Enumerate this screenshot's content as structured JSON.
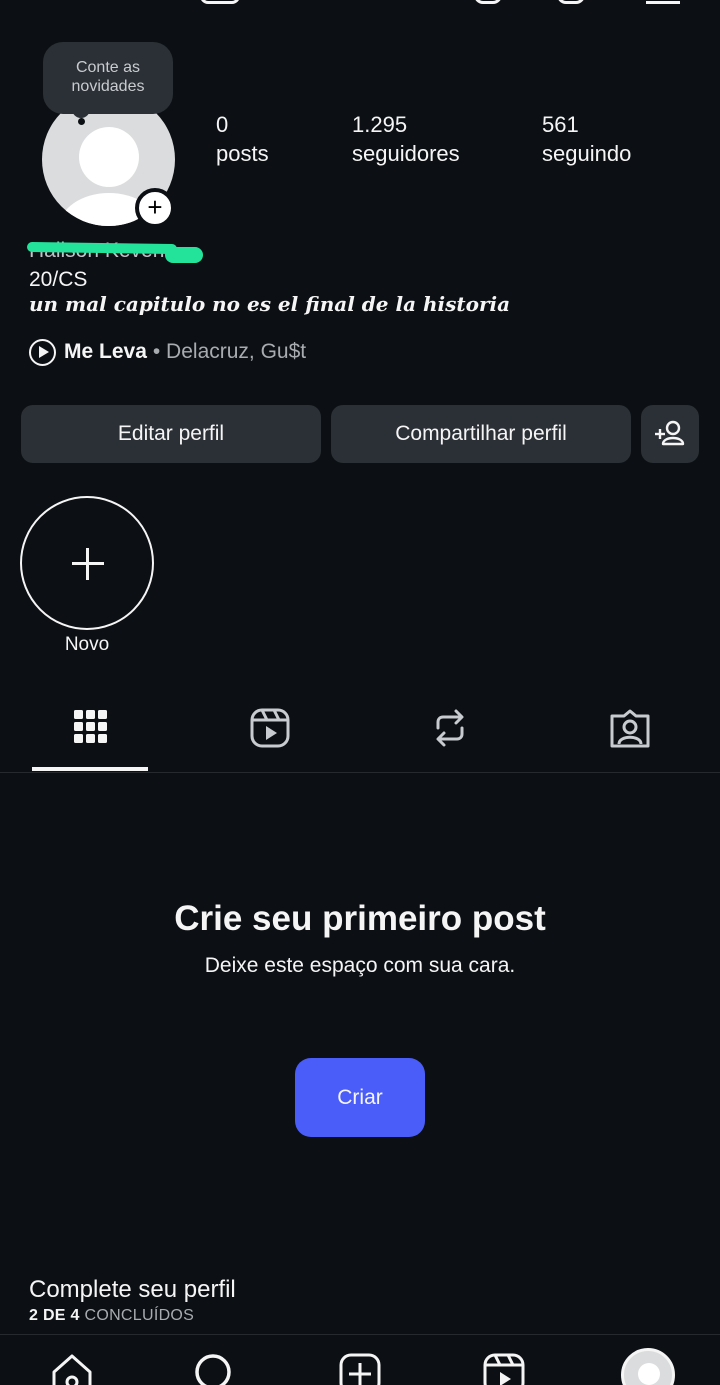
{
  "tooltip": {
    "text": "Conte as novidades"
  },
  "profile": {
    "name_redacted": "Hallson Keven",
    "bio_line1": "20/CS",
    "bio_line2": "un mal capitulo no es el final de la historia",
    "music": {
      "title": "Me Leva",
      "artist": "• Delacruz, Gu$t"
    }
  },
  "stats": [
    {
      "value": "0",
      "label": "posts"
    },
    {
      "value": "1.295",
      "label": "seguidores"
    },
    {
      "value": "561",
      "label": "seguindo"
    }
  ],
  "buttons": {
    "edit": "Editar perfil",
    "share": "Compartilhar perfil",
    "add_person_icon": "add-person-icon"
  },
  "highlight": {
    "label": "Novo"
  },
  "tabs": [
    {
      "icon": "grid-icon",
      "active": true
    },
    {
      "icon": "reels-icon",
      "active": false
    },
    {
      "icon": "repost-icon",
      "active": false
    },
    {
      "icon": "tagged-icon",
      "active": false
    }
  ],
  "empty_state": {
    "title": "Crie seu primeiro post",
    "subtitle": "Deixe este espaço com sua cara.",
    "button": "Criar"
  },
  "complete_profile": {
    "title": "Complete seu perfil",
    "progress_done": "2 DE 4",
    "progress_rest": "CONCLUÍDOS"
  },
  "nav": [
    "home-icon",
    "search-icon",
    "create-icon",
    "reels-icon",
    "profile-avatar"
  ],
  "colors": {
    "background": "#0c1014",
    "button": "#2b3036",
    "accent": "#4a5df9",
    "redaction": "#23e39b"
  }
}
